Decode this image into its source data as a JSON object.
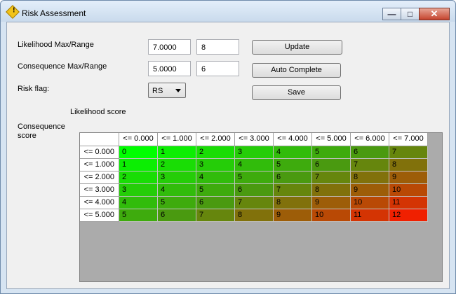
{
  "window": {
    "title": "Risk Assessment",
    "minimize_glyph": "—",
    "maximize_glyph": "□",
    "close_glyph": "✕",
    "icon": "warning-icon"
  },
  "form": {
    "likelihood_label": "Likelihood Max/Range",
    "likelihood_max": "7.0000",
    "likelihood_range": "8",
    "consequence_label": "Consequence Max/Range",
    "consequence_max": "5.0000",
    "consequence_range": "6",
    "risk_flag_label": "Risk flag:",
    "risk_flag_value": "RS"
  },
  "buttons": {
    "update": "Update",
    "auto_complete": "Auto Complete",
    "save": "Save"
  },
  "grid": {
    "likelihood_title": "Likelihood score",
    "consequence_title": "Consequence score",
    "columns": [
      "<= 0.000",
      "<= 1.000",
      "<= 2.000",
      "<= 3.000",
      "<= 4.000",
      "<= 5.000",
      "<= 6.000",
      "<= 7.000"
    ],
    "rows": [
      {
        "label": "<= 0.000",
        "values": [
          "0",
          "1",
          "2",
          "3",
          "4",
          "5",
          "6",
          "7"
        ]
      },
      {
        "label": "<= 1.000",
        "values": [
          "1",
          "2",
          "3",
          "4",
          "5",
          "6",
          "7",
          "8"
        ]
      },
      {
        "label": "<= 2.000",
        "values": [
          "2",
          "3",
          "4",
          "5",
          "6",
          "7",
          "8",
          "9"
        ]
      },
      {
        "label": "<= 3.000",
        "values": [
          "3",
          "4",
          "5",
          "6",
          "7",
          "8",
          "9",
          "10"
        ]
      },
      {
        "label": "<= 4.000",
        "values": [
          "4",
          "5",
          "6",
          "7",
          "8",
          "9",
          "10",
          "11"
        ]
      },
      {
        "label": "<= 5.000",
        "values": [
          "5",
          "6",
          "7",
          "8",
          "9",
          "10",
          "11",
          "12"
        ]
      }
    ],
    "score_min": 0,
    "score_max": 12,
    "color_low": "#00ff00",
    "color_mid": "#4a9a10",
    "color_high": "#f02000"
  }
}
